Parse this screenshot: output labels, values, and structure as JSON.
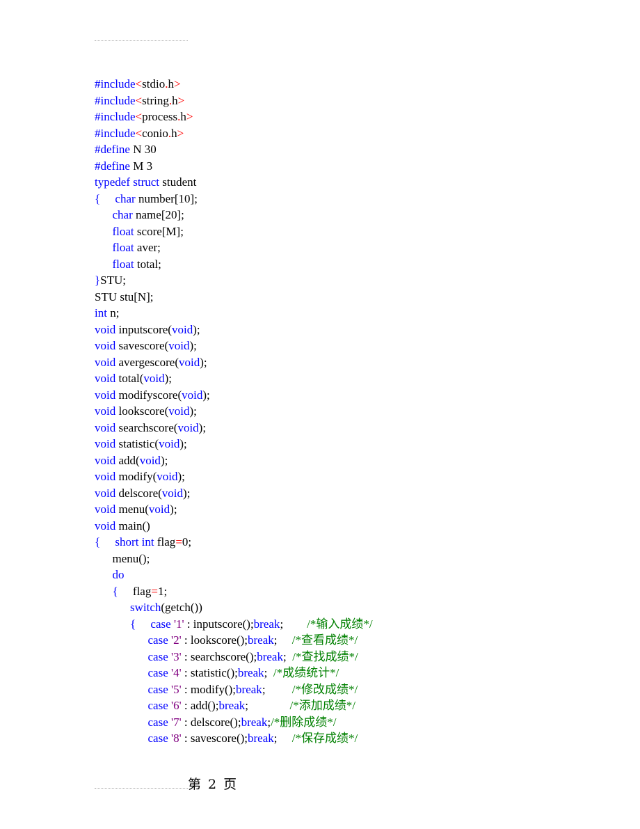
{
  "page": {
    "footer": "第 2 页"
  },
  "code_lines": [
    [
      [
        "k",
        "#include"
      ],
      [
        "r",
        "<"
      ],
      [
        "n",
        "stdio"
      ],
      [
        "r",
        "."
      ],
      [
        "n",
        "h"
      ],
      [
        "r",
        ">"
      ]
    ],
    [
      [
        "k",
        "#include"
      ],
      [
        "r",
        "<"
      ],
      [
        "n",
        "string"
      ],
      [
        "r",
        "."
      ],
      [
        "n",
        "h"
      ],
      [
        "r",
        ">"
      ]
    ],
    [
      [
        "k",
        "#include"
      ],
      [
        "r",
        "<"
      ],
      [
        "n",
        "process"
      ],
      [
        "r",
        "."
      ],
      [
        "n",
        "h"
      ],
      [
        "r",
        ">"
      ]
    ],
    [
      [
        "k",
        "#include"
      ],
      [
        "r",
        "<"
      ],
      [
        "n",
        "conio"
      ],
      [
        "r",
        "."
      ],
      [
        "n",
        "h"
      ],
      [
        "r",
        ">"
      ]
    ],
    [
      [
        "k",
        "#define"
      ],
      [
        "n",
        " N 30"
      ]
    ],
    [
      [
        "k",
        "#define"
      ],
      [
        "n",
        " M 3"
      ]
    ],
    [
      [
        "k",
        "typedef"
      ],
      [
        "n",
        " "
      ],
      [
        "k",
        "struct"
      ],
      [
        "n",
        " student"
      ]
    ],
    [
      [
        "k",
        "{"
      ],
      [
        "n",
        "     "
      ],
      [
        "k",
        "char"
      ],
      [
        "n",
        " number[10];"
      ]
    ],
    [
      [
        "n",
        "      "
      ],
      [
        "k",
        "char"
      ],
      [
        "n",
        " name[20];"
      ]
    ],
    [
      [
        "n",
        "      "
      ],
      [
        "k",
        "float"
      ],
      [
        "n",
        " score[M];"
      ]
    ],
    [
      [
        "n",
        "      "
      ],
      [
        "k",
        "float"
      ],
      [
        "n",
        " aver;"
      ]
    ],
    [
      [
        "n",
        "      "
      ],
      [
        "k",
        "float"
      ],
      [
        "n",
        " total;"
      ]
    ],
    [
      [
        "k",
        "}"
      ],
      [
        "n",
        "STU;"
      ]
    ],
    [
      [
        "n",
        "STU stu[N];"
      ]
    ],
    [
      [
        "k",
        "int"
      ],
      [
        "n",
        " n;"
      ]
    ],
    [
      [
        "k",
        "void"
      ],
      [
        "n",
        " inputscore("
      ],
      [
        "k",
        "void"
      ],
      [
        "n",
        ");"
      ]
    ],
    [
      [
        "k",
        "void"
      ],
      [
        "n",
        " savescore("
      ],
      [
        "k",
        "void"
      ],
      [
        "n",
        ");"
      ]
    ],
    [
      [
        "k",
        "void"
      ],
      [
        "n",
        " avergescore("
      ],
      [
        "k",
        "void"
      ],
      [
        "n",
        ");"
      ]
    ],
    [
      [
        "k",
        "void"
      ],
      [
        "n",
        " total("
      ],
      [
        "k",
        "void"
      ],
      [
        "n",
        ");"
      ]
    ],
    [
      [
        "k",
        "void"
      ],
      [
        "n",
        " modifyscore("
      ],
      [
        "k",
        "void"
      ],
      [
        "n",
        ");"
      ]
    ],
    [
      [
        "k",
        "void"
      ],
      [
        "n",
        " lookscore("
      ],
      [
        "k",
        "void"
      ],
      [
        "n",
        ");"
      ]
    ],
    [
      [
        "k",
        "void"
      ],
      [
        "n",
        " searchscore("
      ],
      [
        "k",
        "void"
      ],
      [
        "n",
        ");"
      ]
    ],
    [
      [
        "k",
        "void"
      ],
      [
        "n",
        " statistic("
      ],
      [
        "k",
        "void"
      ],
      [
        "n",
        ");"
      ]
    ],
    [
      [
        "k",
        "void"
      ],
      [
        "n",
        " add("
      ],
      [
        "k",
        "void"
      ],
      [
        "n",
        ");"
      ]
    ],
    [
      [
        "k",
        "void"
      ],
      [
        "n",
        " modify("
      ],
      [
        "k",
        "void"
      ],
      [
        "n",
        ");"
      ]
    ],
    [
      [
        "k",
        "void"
      ],
      [
        "n",
        " delscore("
      ],
      [
        "k",
        "void"
      ],
      [
        "n",
        ");"
      ]
    ],
    [
      [
        "k",
        "void"
      ],
      [
        "n",
        " menu("
      ],
      [
        "k",
        "void"
      ],
      [
        "n",
        ");"
      ]
    ],
    [
      [
        "k",
        "void"
      ],
      [
        "n",
        " main()"
      ]
    ],
    [
      [
        "k",
        "{"
      ],
      [
        "n",
        "     "
      ],
      [
        "k",
        "short int"
      ],
      [
        "n",
        " flag"
      ],
      [
        "r",
        "="
      ],
      [
        "n",
        "0;"
      ]
    ],
    [
      [
        "n",
        "      menu();"
      ]
    ],
    [
      [
        "n",
        "      "
      ],
      [
        "k",
        "do"
      ]
    ],
    [
      [
        "n",
        "      "
      ],
      [
        "k",
        "{"
      ],
      [
        "n",
        "     flag"
      ],
      [
        "r",
        "="
      ],
      [
        "n",
        "1;"
      ]
    ],
    [
      [
        "n",
        "            "
      ],
      [
        "k",
        "switch"
      ],
      [
        "n",
        "(getch())"
      ]
    ],
    [
      [
        "n",
        "            "
      ],
      [
        "k",
        "{"
      ],
      [
        "n",
        "     "
      ],
      [
        "k",
        "case"
      ],
      [
        "n",
        " "
      ],
      [
        "p",
        "'1'"
      ],
      [
        "n",
        " : inputscore();"
      ],
      [
        "k",
        "break"
      ],
      [
        "n",
        ";        "
      ],
      [
        "c",
        "/*输入成绩*/"
      ]
    ],
    [
      [
        "n",
        "                  "
      ],
      [
        "k",
        "case"
      ],
      [
        "n",
        " "
      ],
      [
        "p",
        "'2'"
      ],
      [
        "n",
        " : lookscore();"
      ],
      [
        "k",
        "break"
      ],
      [
        "n",
        ";     "
      ],
      [
        "c",
        "/*查看成绩*/"
      ]
    ],
    [
      [
        "n",
        "                  "
      ],
      [
        "k",
        "case"
      ],
      [
        "n",
        " "
      ],
      [
        "p",
        "'3'"
      ],
      [
        "n",
        " : searchscore();"
      ],
      [
        "k",
        "break"
      ],
      [
        "n",
        ";  "
      ],
      [
        "c",
        "/*查找成绩*/"
      ]
    ],
    [
      [
        "n",
        "                  "
      ],
      [
        "k",
        "case"
      ],
      [
        "n",
        " "
      ],
      [
        "p",
        "'4'"
      ],
      [
        "n",
        " : statistic();"
      ],
      [
        "k",
        "break"
      ],
      [
        "n",
        ";  "
      ],
      [
        "c",
        "/*成绩统计*/"
      ]
    ],
    [
      [
        "n",
        "                  "
      ],
      [
        "k",
        "case"
      ],
      [
        "n",
        " "
      ],
      [
        "p",
        "'5'"
      ],
      [
        "n",
        " : modify();"
      ],
      [
        "k",
        "break"
      ],
      [
        "n",
        ";         "
      ],
      [
        "c",
        "/*修改成绩*/"
      ]
    ],
    [
      [
        "n",
        "                  "
      ],
      [
        "k",
        "case"
      ],
      [
        "n",
        " "
      ],
      [
        "p",
        "'6'"
      ],
      [
        "n",
        " : add();"
      ],
      [
        "k",
        "break"
      ],
      [
        "n",
        ";              "
      ],
      [
        "c",
        "/*添加成绩*/"
      ]
    ],
    [
      [
        "n",
        "                  "
      ],
      [
        "k",
        "case"
      ],
      [
        "n",
        " "
      ],
      [
        "p",
        "'7'"
      ],
      [
        "n",
        " : delscore();"
      ],
      [
        "k",
        "break"
      ],
      [
        "n",
        ";"
      ],
      [
        "c",
        "/*删除成绩*/"
      ]
    ],
    [
      [
        "n",
        "                  "
      ],
      [
        "k",
        "case"
      ],
      [
        "n",
        " "
      ],
      [
        "p",
        "'8'"
      ],
      [
        "n",
        " : savescore();"
      ],
      [
        "k",
        "break"
      ],
      [
        "n",
        ";     "
      ],
      [
        "c",
        "/*保存成绩*/"
      ]
    ]
  ]
}
